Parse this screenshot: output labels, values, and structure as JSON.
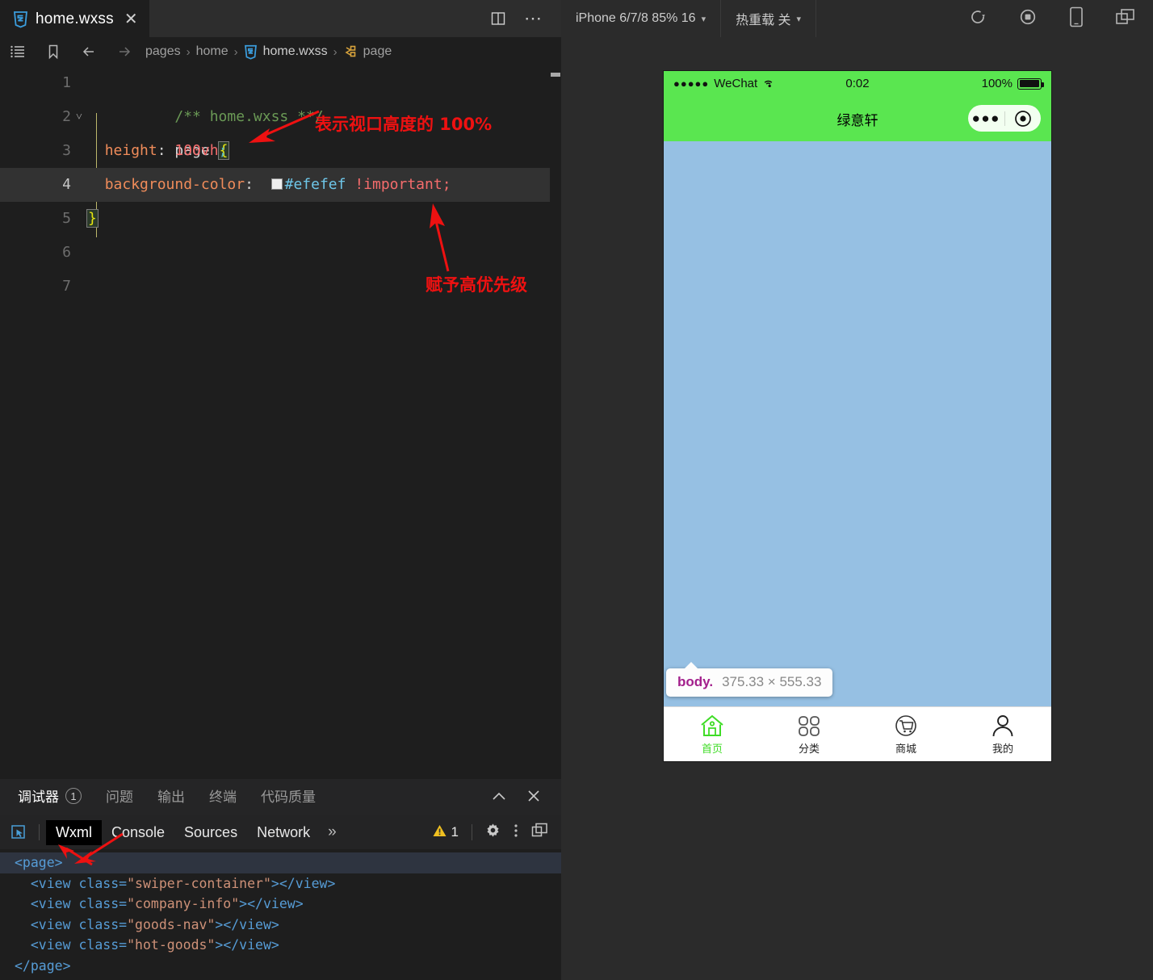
{
  "editor": {
    "tab": {
      "filename": "home.wxss",
      "close_label": "✕",
      "icon": "wxss-file-icon"
    },
    "toolbar_right": {
      "split_icon": "split-editor-icon",
      "more_icon": "more-options-icon",
      "more_label": "⋯"
    },
    "breadcrumb": {
      "icons": [
        "outline-list-icon",
        "bookmark-icon",
        "arrow-left-icon",
        "arrow-right-icon"
      ],
      "segments": [
        "pages",
        "home",
        "home.wxss",
        "page"
      ],
      "separator": "›"
    },
    "code": {
      "lines": [
        {
          "num": "1",
          "text": "/** home.wxss **/"
        },
        {
          "num": "2",
          "text": "page {"
        },
        {
          "num": "3",
          "text": "  height: 100vh;"
        },
        {
          "num": "4",
          "text": "  background-color: #efefef !important;"
        },
        {
          "num": "5",
          "text": "}"
        },
        {
          "num": "6",
          "text": ""
        },
        {
          "num": "7",
          "text": ""
        }
      ],
      "comment_text": "/** home.wxss **/",
      "selector": "page",
      "open_brace": "{",
      "close_brace": "}",
      "prop1": "height",
      "val1_num": "100vh",
      "prop2": "background-color",
      "color_value": "#efefef",
      "color_swatch": "#efefef",
      "important": "!important",
      "semicolon": ";",
      "colon": ":",
      "active_line": "4"
    },
    "annotations": [
      {
        "id": "anno-viewport-height",
        "text": "表示视口高度的 100%",
        "color": "#ee1111"
      },
      {
        "id": "anno-priority",
        "text": "赋予高优先级",
        "color": "#ee1111"
      }
    ]
  },
  "devpanel": {
    "tabs": [
      {
        "label": "调试器",
        "badge": "1",
        "selected": true
      },
      {
        "label": "问题",
        "badge": "",
        "selected": false
      },
      {
        "label": "输出",
        "badge": "",
        "selected": false
      },
      {
        "label": "终端",
        "badge": "",
        "selected": false
      },
      {
        "label": "代码质量",
        "badge": "",
        "selected": false
      }
    ],
    "collapse_icon": "chevron-up-icon",
    "close_icon": "close-icon",
    "devtools_tabs": [
      {
        "label": "Wxml",
        "selected": true
      },
      {
        "label": "Console",
        "selected": false
      },
      {
        "label": "Sources",
        "selected": false
      },
      {
        "label": "Network",
        "selected": false
      }
    ],
    "overflow_label": "»",
    "warning_count": "1",
    "warning_icon": "warning-triangle-icon",
    "settings_icon": "gear-icon",
    "kebab_icon": "more-vertical-icon",
    "dock_icon": "dock-panel-icon",
    "inspect_icon": "inspect-element-icon",
    "wxml": {
      "root_open": "<page>",
      "root_close": "</page>",
      "children": [
        {
          "tag_open": "<view class=",
          "cls": "\"swiper-container\"",
          "tag_rest": ">",
          "tag_close": "</view>"
        },
        {
          "tag_open": "<view class=",
          "cls": "\"company-info\"",
          "tag_rest": ">",
          "tag_close": "</view>"
        },
        {
          "tag_open": "<view class=",
          "cls": "\"goods-nav\"",
          "tag_rest": ">",
          "tag_close": "</view>"
        },
        {
          "tag_open": "<view class=",
          "cls": "\"hot-goods\"",
          "tag_rest": ">",
          "tag_close": "</view>"
        }
      ]
    }
  },
  "simulator": {
    "toolbar": {
      "device": "iPhone 6/7/8 85% 16",
      "hot_reload": "热重载 关",
      "caret": "▾",
      "icons": [
        "refresh-icon",
        "stop-record-icon",
        "device-preview-icon",
        "detach-window-icon"
      ]
    },
    "statusbar": {
      "signal_dots": "●●●●●",
      "carrier": "WeChat",
      "wifi_icon": "wifi-icon",
      "time": "0:02",
      "battery_percent": "100%",
      "battery_icon": "battery-full-icon"
    },
    "navbar": {
      "title": "绿意轩",
      "capsule_menu_icon": "capsule-menu-dots-icon",
      "capsule_menu_label": "●●●",
      "capsule_target_icon": "capsule-target-icon"
    },
    "tooltip": {
      "selector": "body.",
      "dimensions": "375.33 × 555.33"
    },
    "body_bg": "#96c0e3",
    "tabbar": [
      {
        "label": "首页",
        "icon": "home-icon",
        "active": true
      },
      {
        "label": "分类",
        "icon": "category-icon",
        "active": false
      },
      {
        "label": "商城",
        "icon": "shop-cart-icon",
        "active": false
      },
      {
        "label": "我的",
        "icon": "user-icon",
        "active": false
      }
    ],
    "active_color": "#3fdc26"
  }
}
